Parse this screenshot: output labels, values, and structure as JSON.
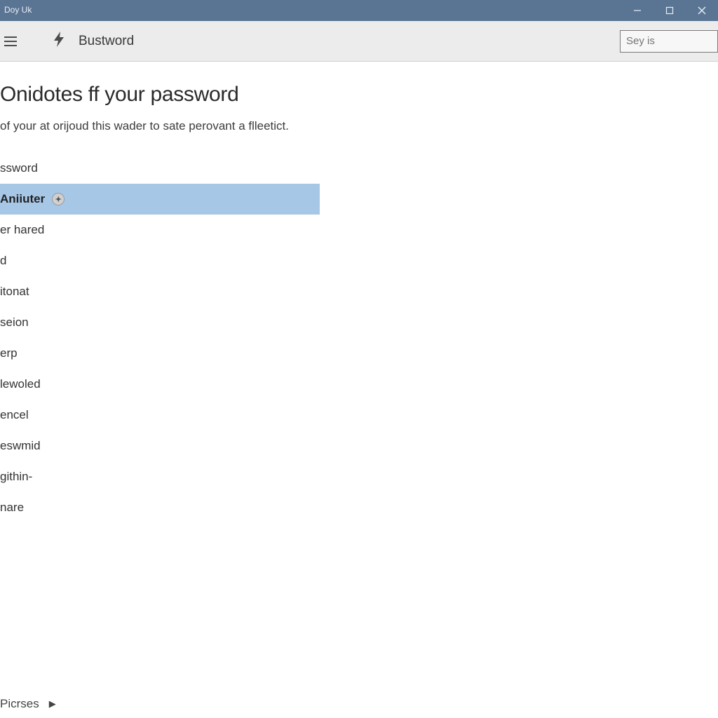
{
  "window": {
    "title": "Doy Uk"
  },
  "toolbar": {
    "crumb": "Bustword",
    "search_placeholder": "Sey is"
  },
  "page": {
    "heading": "Onidotes ff your password",
    "subheading": "of your at orijoud this wader to sate perovant a flleetict.",
    "options": [
      {
        "label": "ssword",
        "selected": false,
        "has_badge": false
      },
      {
        "label": "Aniiuter",
        "selected": true,
        "has_badge": true
      },
      {
        "label": "er hared",
        "selected": false,
        "has_badge": false
      },
      {
        "label": "d",
        "selected": false,
        "has_badge": false
      },
      {
        "label": "itonat",
        "selected": false,
        "has_badge": false
      },
      {
        "label": "seion",
        "selected": false,
        "has_badge": false
      },
      {
        "label": "erp",
        "selected": false,
        "has_badge": false
      },
      {
        "label": "lewoled",
        "selected": false,
        "has_badge": false
      },
      {
        "label": "encel",
        "selected": false,
        "has_badge": false
      },
      {
        "label": "eswmid",
        "selected": false,
        "has_badge": false
      },
      {
        "label": "githin-",
        "selected": false,
        "has_badge": false
      },
      {
        "label": "nare",
        "selected": false,
        "has_badge": false
      }
    ]
  },
  "footer": {
    "label": "Picrses"
  },
  "colors": {
    "titlebar_bg": "#5a7593",
    "toolbar_bg": "#ececec",
    "selection_bg": "#a7c7e7"
  }
}
